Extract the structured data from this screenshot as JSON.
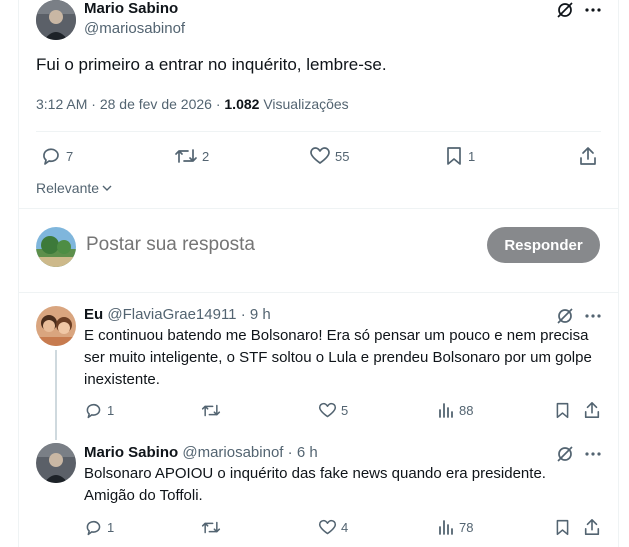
{
  "main_tweet": {
    "author_name": "Mario Sabino",
    "author_handle": "@mariosabinof",
    "text": "Fui o primeiro a entrar no inquérito, lembre-se.",
    "time": "3:12 AM",
    "date": "28 de fev de 2026",
    "views_count": "1.082",
    "views_label": "Visualizações",
    "replies": "7",
    "retweets": "2",
    "likes": "55",
    "bookmarks": "1"
  },
  "sort": {
    "label": "Relevante"
  },
  "composer": {
    "placeholder": "Postar sua resposta",
    "button_label": "Responder"
  },
  "replies": [
    {
      "author_name": "Eu",
      "author_handle": "@FlaviaGrae14911",
      "time": "9 h",
      "text": "E continuou batendo me Bolsonaro! Era só pensar um pouco e nem precisa ser muito inteligente, o STF soltou o Lula e prendeu Bolsonaro por um golpe inexistente.",
      "replies": "1",
      "likes": "5",
      "views": "88"
    },
    {
      "author_name": "Mario Sabino",
      "author_handle": "@mariosabinof",
      "time": "6 h",
      "text": "Bolsonaro APOIOU o inquérito das fake news quando era presidente. Amigão do Toffoli.",
      "replies": "1",
      "likes": "4",
      "views": "78"
    }
  ],
  "colors": {
    "text": "#0f1419",
    "muted": "#536471",
    "divider": "#eff3f4",
    "button": "#87898c",
    "thread_line": "#cfd9de"
  },
  "icons": [
    "grok-icon",
    "more-icon",
    "reply-icon",
    "retweet-icon",
    "like-icon",
    "bookmark-icon",
    "share-icon",
    "views-icon",
    "chevron-down-icon"
  ]
}
